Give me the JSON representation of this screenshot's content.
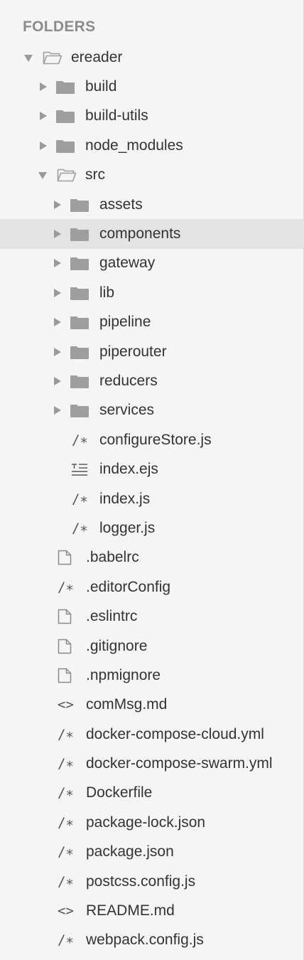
{
  "sidebar": {
    "section_title": "FOLDERS",
    "items": [
      {
        "label": "ereader",
        "depth": 0,
        "kind": "folder",
        "expanded": true,
        "icon": "folder-open-icon"
      },
      {
        "label": "build",
        "depth": 1,
        "kind": "folder",
        "expanded": false,
        "icon": "folder-icon"
      },
      {
        "label": "build-utils",
        "depth": 1,
        "kind": "folder",
        "expanded": false,
        "icon": "folder-icon"
      },
      {
        "label": "node_modules",
        "depth": 1,
        "kind": "folder",
        "expanded": false,
        "icon": "folder-icon"
      },
      {
        "label": "src",
        "depth": 1,
        "kind": "folder",
        "expanded": true,
        "icon": "folder-open-icon"
      },
      {
        "label": "assets",
        "depth": 2,
        "kind": "folder",
        "expanded": false,
        "icon": "folder-icon"
      },
      {
        "label": "components",
        "depth": 2,
        "kind": "folder",
        "expanded": false,
        "icon": "folder-icon",
        "selected": true
      },
      {
        "label": "gateway",
        "depth": 2,
        "kind": "folder",
        "expanded": false,
        "icon": "folder-icon"
      },
      {
        "label": "lib",
        "depth": 2,
        "kind": "folder",
        "expanded": false,
        "icon": "folder-icon"
      },
      {
        "label": "pipeline",
        "depth": 2,
        "kind": "folder",
        "expanded": false,
        "icon": "folder-icon"
      },
      {
        "label": "piperouter",
        "depth": 2,
        "kind": "folder",
        "expanded": false,
        "icon": "folder-icon"
      },
      {
        "label": "reducers",
        "depth": 2,
        "kind": "folder",
        "expanded": false,
        "icon": "folder-icon"
      },
      {
        "label": "services",
        "depth": 2,
        "kind": "folder",
        "expanded": false,
        "icon": "folder-icon"
      },
      {
        "label": "configureStore.js",
        "depth": 2,
        "kind": "file",
        "icon": "code-comment-icon",
        "glyph": "/∗"
      },
      {
        "label": "index.ejs",
        "depth": 2,
        "kind": "file",
        "icon": "text-lines-icon",
        "glyph": "☰"
      },
      {
        "label": "index.js",
        "depth": 2,
        "kind": "file",
        "icon": "code-comment-icon",
        "glyph": "/∗"
      },
      {
        "label": "logger.js",
        "depth": 2,
        "kind": "file",
        "icon": "code-comment-icon",
        "glyph": "/∗"
      },
      {
        "label": ".babelrc",
        "depth": 1,
        "kind": "file",
        "icon": "document-icon"
      },
      {
        "label": ".editorConfig",
        "depth": 1,
        "kind": "file",
        "icon": "code-comment-icon",
        "glyph": "/∗"
      },
      {
        "label": ".eslintrc",
        "depth": 1,
        "kind": "file",
        "icon": "document-icon"
      },
      {
        "label": ".gitignore",
        "depth": 1,
        "kind": "file",
        "icon": "document-icon"
      },
      {
        "label": ".npmignore",
        "depth": 1,
        "kind": "file",
        "icon": "document-icon"
      },
      {
        "label": "comMsg.md",
        "depth": 1,
        "kind": "file",
        "icon": "markup-icon",
        "glyph": "<>"
      },
      {
        "label": "docker-compose-cloud.yml",
        "depth": 1,
        "kind": "file",
        "icon": "code-comment-icon",
        "glyph": "/∗"
      },
      {
        "label": "docker-compose-swarm.yml",
        "depth": 1,
        "kind": "file",
        "icon": "code-comment-icon",
        "glyph": "/∗"
      },
      {
        "label": "Dockerfile",
        "depth": 1,
        "kind": "file",
        "icon": "code-comment-icon",
        "glyph": "/∗"
      },
      {
        "label": "package-lock.json",
        "depth": 1,
        "kind": "file",
        "icon": "code-comment-icon",
        "glyph": "/∗"
      },
      {
        "label": "package.json",
        "depth": 1,
        "kind": "file",
        "icon": "code-comment-icon",
        "glyph": "/∗"
      },
      {
        "label": "postcss.config.js",
        "depth": 1,
        "kind": "file",
        "icon": "code-comment-icon",
        "glyph": "/∗"
      },
      {
        "label": "README.md",
        "depth": 1,
        "kind": "file",
        "icon": "markup-icon",
        "glyph": "<>"
      },
      {
        "label": "webpack.config.js",
        "depth": 1,
        "kind": "file",
        "icon": "code-comment-icon",
        "glyph": "/∗"
      }
    ]
  },
  "colors": {
    "background": "#f5f5f5",
    "selected_row": "#e3e3e3",
    "folder_fill": "#9e9e9e",
    "icon_gray": "#8a8a8a",
    "section_title": "#8c8c8c",
    "text": "#333333"
  }
}
